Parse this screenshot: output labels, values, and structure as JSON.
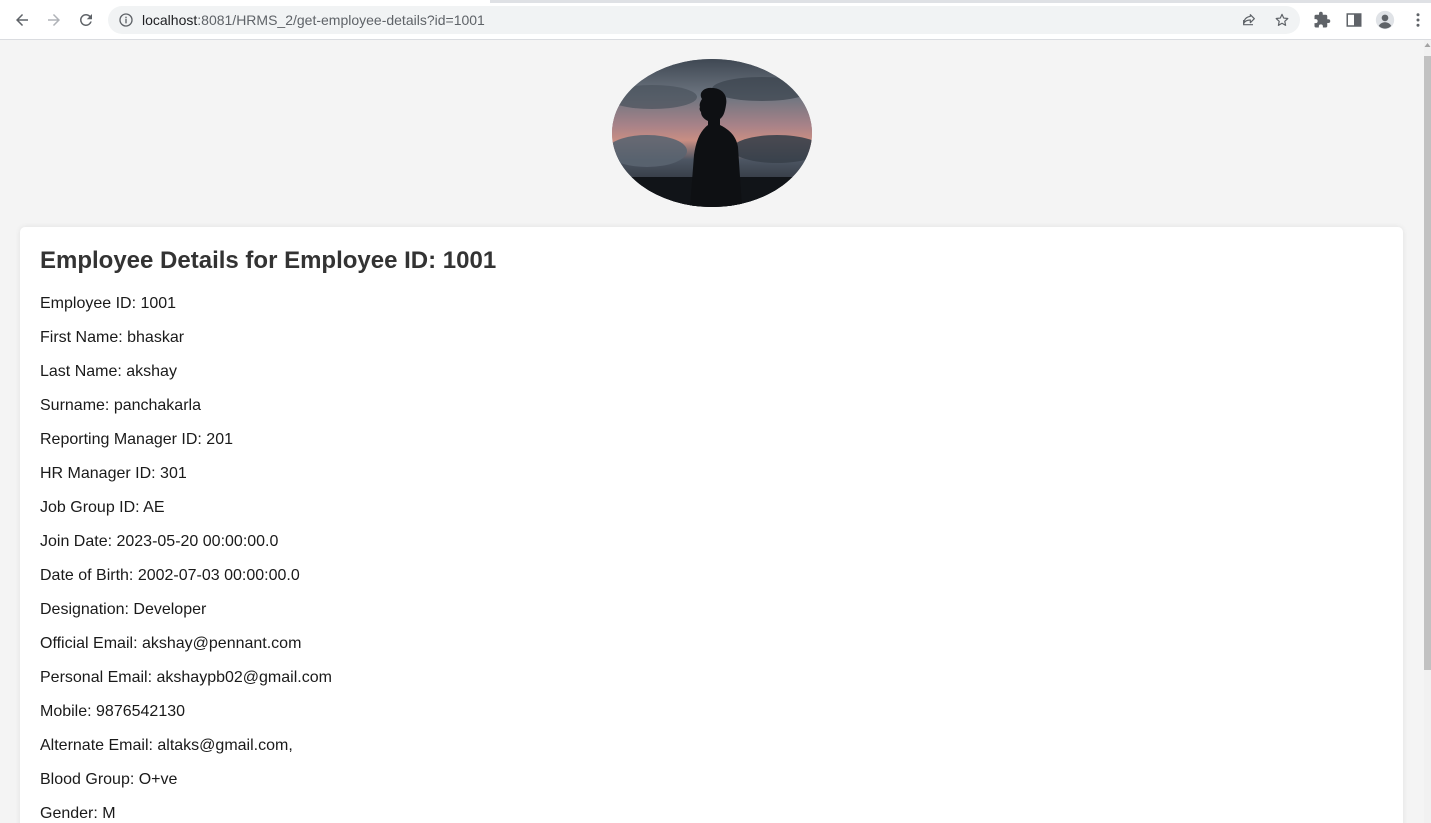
{
  "browser": {
    "url_host": "localhost",
    "url_rest": ":8081/HRMS_2/get-employee-details?id=1001",
    "icons": [
      "back-arrow-icon",
      "forward-arrow-icon",
      "reload-icon",
      "site-info-icon",
      "share-icon",
      "star-icon",
      "extensions-icon",
      "side-panel-icon",
      "profile-icon",
      "more-menu-icon"
    ]
  },
  "page": {
    "heading": "Employee Details for Employee ID: 1001",
    "details": [
      "Employee ID: 1001",
      "First Name: bhaskar",
      "Last Name: akshay",
      "Surname: panchakarla",
      "Reporting Manager ID: 201",
      "HR Manager ID: 301",
      "Job Group ID: AE",
      "Join Date: 2023-05-20 00:00:00.0",
      "Date of Birth: 2002-07-03 00:00:00.0",
      "Designation: Developer",
      "Official Email: akshay@pennant.com",
      "Personal Email: akshaypb02@gmail.com",
      "Mobile: 9876542130",
      "Alternate Email: altaks@gmail.com,",
      "Blood Group: O+ve",
      "Gender: M"
    ]
  },
  "colors": {
    "page_background": "#f4f4f4",
    "card_background": "#ffffff",
    "heading_color": "#333333"
  }
}
